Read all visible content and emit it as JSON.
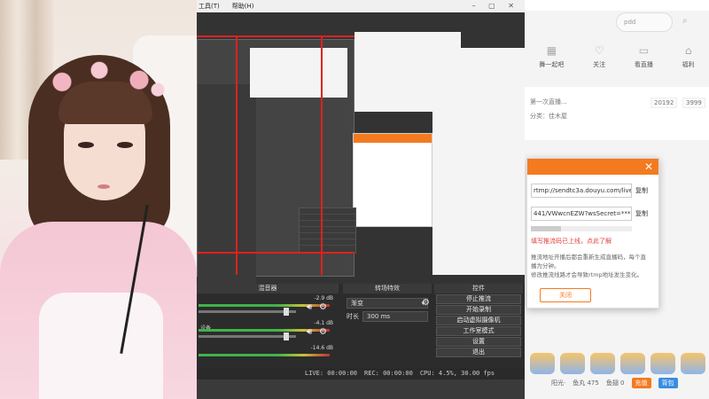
{
  "obs": {
    "menu": [
      "工具(T)",
      "帮助(H)"
    ],
    "mixer": {
      "title": "混音器",
      "tracks": [
        {
          "label": "",
          "db": "-2.9 dB",
          "level": 0.55
        },
        {
          "label": "设备",
          "db": "-4.1 dB",
          "level": 0.6
        },
        {
          "label": "",
          "db": "-14.6 dB",
          "level": 0.45
        }
      ]
    },
    "transitions": {
      "title": "转场特效",
      "selected": "渐变",
      "duration_label": "时长",
      "duration_value": "300 ms"
    },
    "controls": {
      "title": "控件",
      "buttons": [
        "停止推流",
        "开始录制",
        "启动虚拟摄像机",
        "工作室模式",
        "设置",
        "退出"
      ]
    },
    "status": {
      "live": "LIVE: 00:00:00",
      "rec": "REC: 00:00:00",
      "cpu": "CPU: 4.5%, 30.00 fps"
    }
  },
  "browser": {
    "search_placeholder": "pdd",
    "nav": [
      {
        "label": "舞一起吧",
        "icon": "grid-icon"
      },
      {
        "label": "关注",
        "icon": "heart-icon"
      },
      {
        "label": "看直播",
        "icon": "tv-icon"
      },
      {
        "label": "福利",
        "icon": "gift-icon"
      }
    ],
    "info": {
      "text1": "第一次直播...",
      "text2": "分类：佳木屋",
      "badge1": "20192",
      "badge2": "3999"
    },
    "dialog": {
      "server_value": "rtmp://sendtc3a.douyu.com/live",
      "key_value": "441/VWwcnEZW?wsSecret=*******",
      "copy_label": "复制",
      "warning": "填写推流码已上线，点此了解",
      "tip1": "推流地址开播后都会重新生成直播码，每个直",
      "tip2": "播为分钟。",
      "tip3": "修改推流线路才会导致rtmp地址发生变化。",
      "close_label": "关闭"
    },
    "bottom": {
      "item1": "阳光·",
      "item2": "鱼丸 475",
      "item3": "鱼翅 0",
      "btn1": "充值",
      "btn2": "背包"
    }
  }
}
